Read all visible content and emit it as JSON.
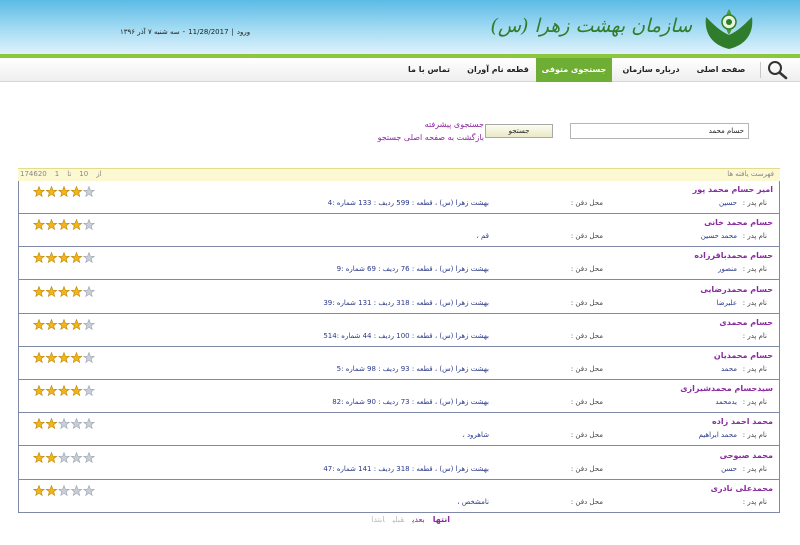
{
  "brand": {
    "name": "سازمان بهشت زهرا (س)",
    "colors": {
      "header_blue": "#5bbbe6",
      "nav_green": "#6fae34",
      "link_purple": "#8b2aa0"
    }
  },
  "header": {
    "login_label": "ورود",
    "date_gregorian": "11/28/2017",
    "date_persian": "سه شنبه ۷ آذر ۱۳۹۶"
  },
  "nav": {
    "items": [
      {
        "label": "صفحه اصلی",
        "active": false
      },
      {
        "label": "درباره سازمان",
        "active": false
      },
      {
        "label": "جستجوی متوفی",
        "active": true
      },
      {
        "label": "قطعه نام آوران",
        "active": false
      },
      {
        "label": "تماس با ما",
        "active": false
      }
    ],
    "search_icon": "search-icon"
  },
  "search": {
    "query_value": "حسام محمد",
    "button_label": "جستجو",
    "advanced_link": "جستجوی پیشرفته",
    "back_link": "بازگشت به صفحه اصلی جستجو"
  },
  "results": {
    "title": "فهرست یافته ها",
    "pager": {
      "from": "1",
      "to_label": "تا",
      "to": "10",
      "of_label": "از",
      "total": "174620"
    },
    "father_label": "نام پدر :",
    "burial_label": "محل دفن :",
    "items": [
      {
        "name": "امیر حسام محمد پور",
        "father": "حسین",
        "burial": "بهشت زهرا (س) ، قطعه : 599 ردیف : 133 شماره :4",
        "stars": 4
      },
      {
        "name": "حسام محمد خانی",
        "father": "محمد حسین",
        "burial": "قم ،",
        "stars": 4
      },
      {
        "name": "حسام محمدباقرزاده",
        "father": "منصور",
        "burial": "بهشت زهرا (س) ، قطعه : 76 ردیف : 69 شماره :9",
        "stars": 4
      },
      {
        "name": "حسام محمدرضایی",
        "father": "علیرضا",
        "burial": "بهشت زهرا (س) ، قطعه : 318 ردیف : 131 شماره :39",
        "stars": 4
      },
      {
        "name": "حسام محمدی",
        "father": "",
        "burial": "بهشت زهرا (س) ، قطعه : 100 ردیف : 44 شماره :514",
        "stars": 4
      },
      {
        "name": "حسام محمدیان",
        "father": "محمد",
        "burial": "بهشت زهرا (س) ، قطعه : 93 ردیف : 98 شماره :5",
        "stars": 4
      },
      {
        "name": "سیدحسام محمدشیرازی",
        "father": "یدمحمد",
        "burial": "بهشت زهرا (س) ، قطعه : 73 ردیف : 90 شماره :82",
        "stars": 4
      },
      {
        "name": "محمد احمد زاده",
        "father": "محمد ابراهیم",
        "burial": "شاهرود ،",
        "stars": 2
      },
      {
        "name": "محمد صبوحی",
        "father": "حسن",
        "burial": "بهشت زهرا (س) ، قطعه : 318 ردیف : 141 شماره :47",
        "stars": 2
      },
      {
        "name": "محمدعلی نادری",
        "father": "",
        "burial": "نامشخص ،",
        "stars": 2
      }
    ]
  },
  "bottom_pager": {
    "last": "انتها",
    "next": "بعدی",
    "prev": "قبلی",
    "first": "ابتدا"
  }
}
